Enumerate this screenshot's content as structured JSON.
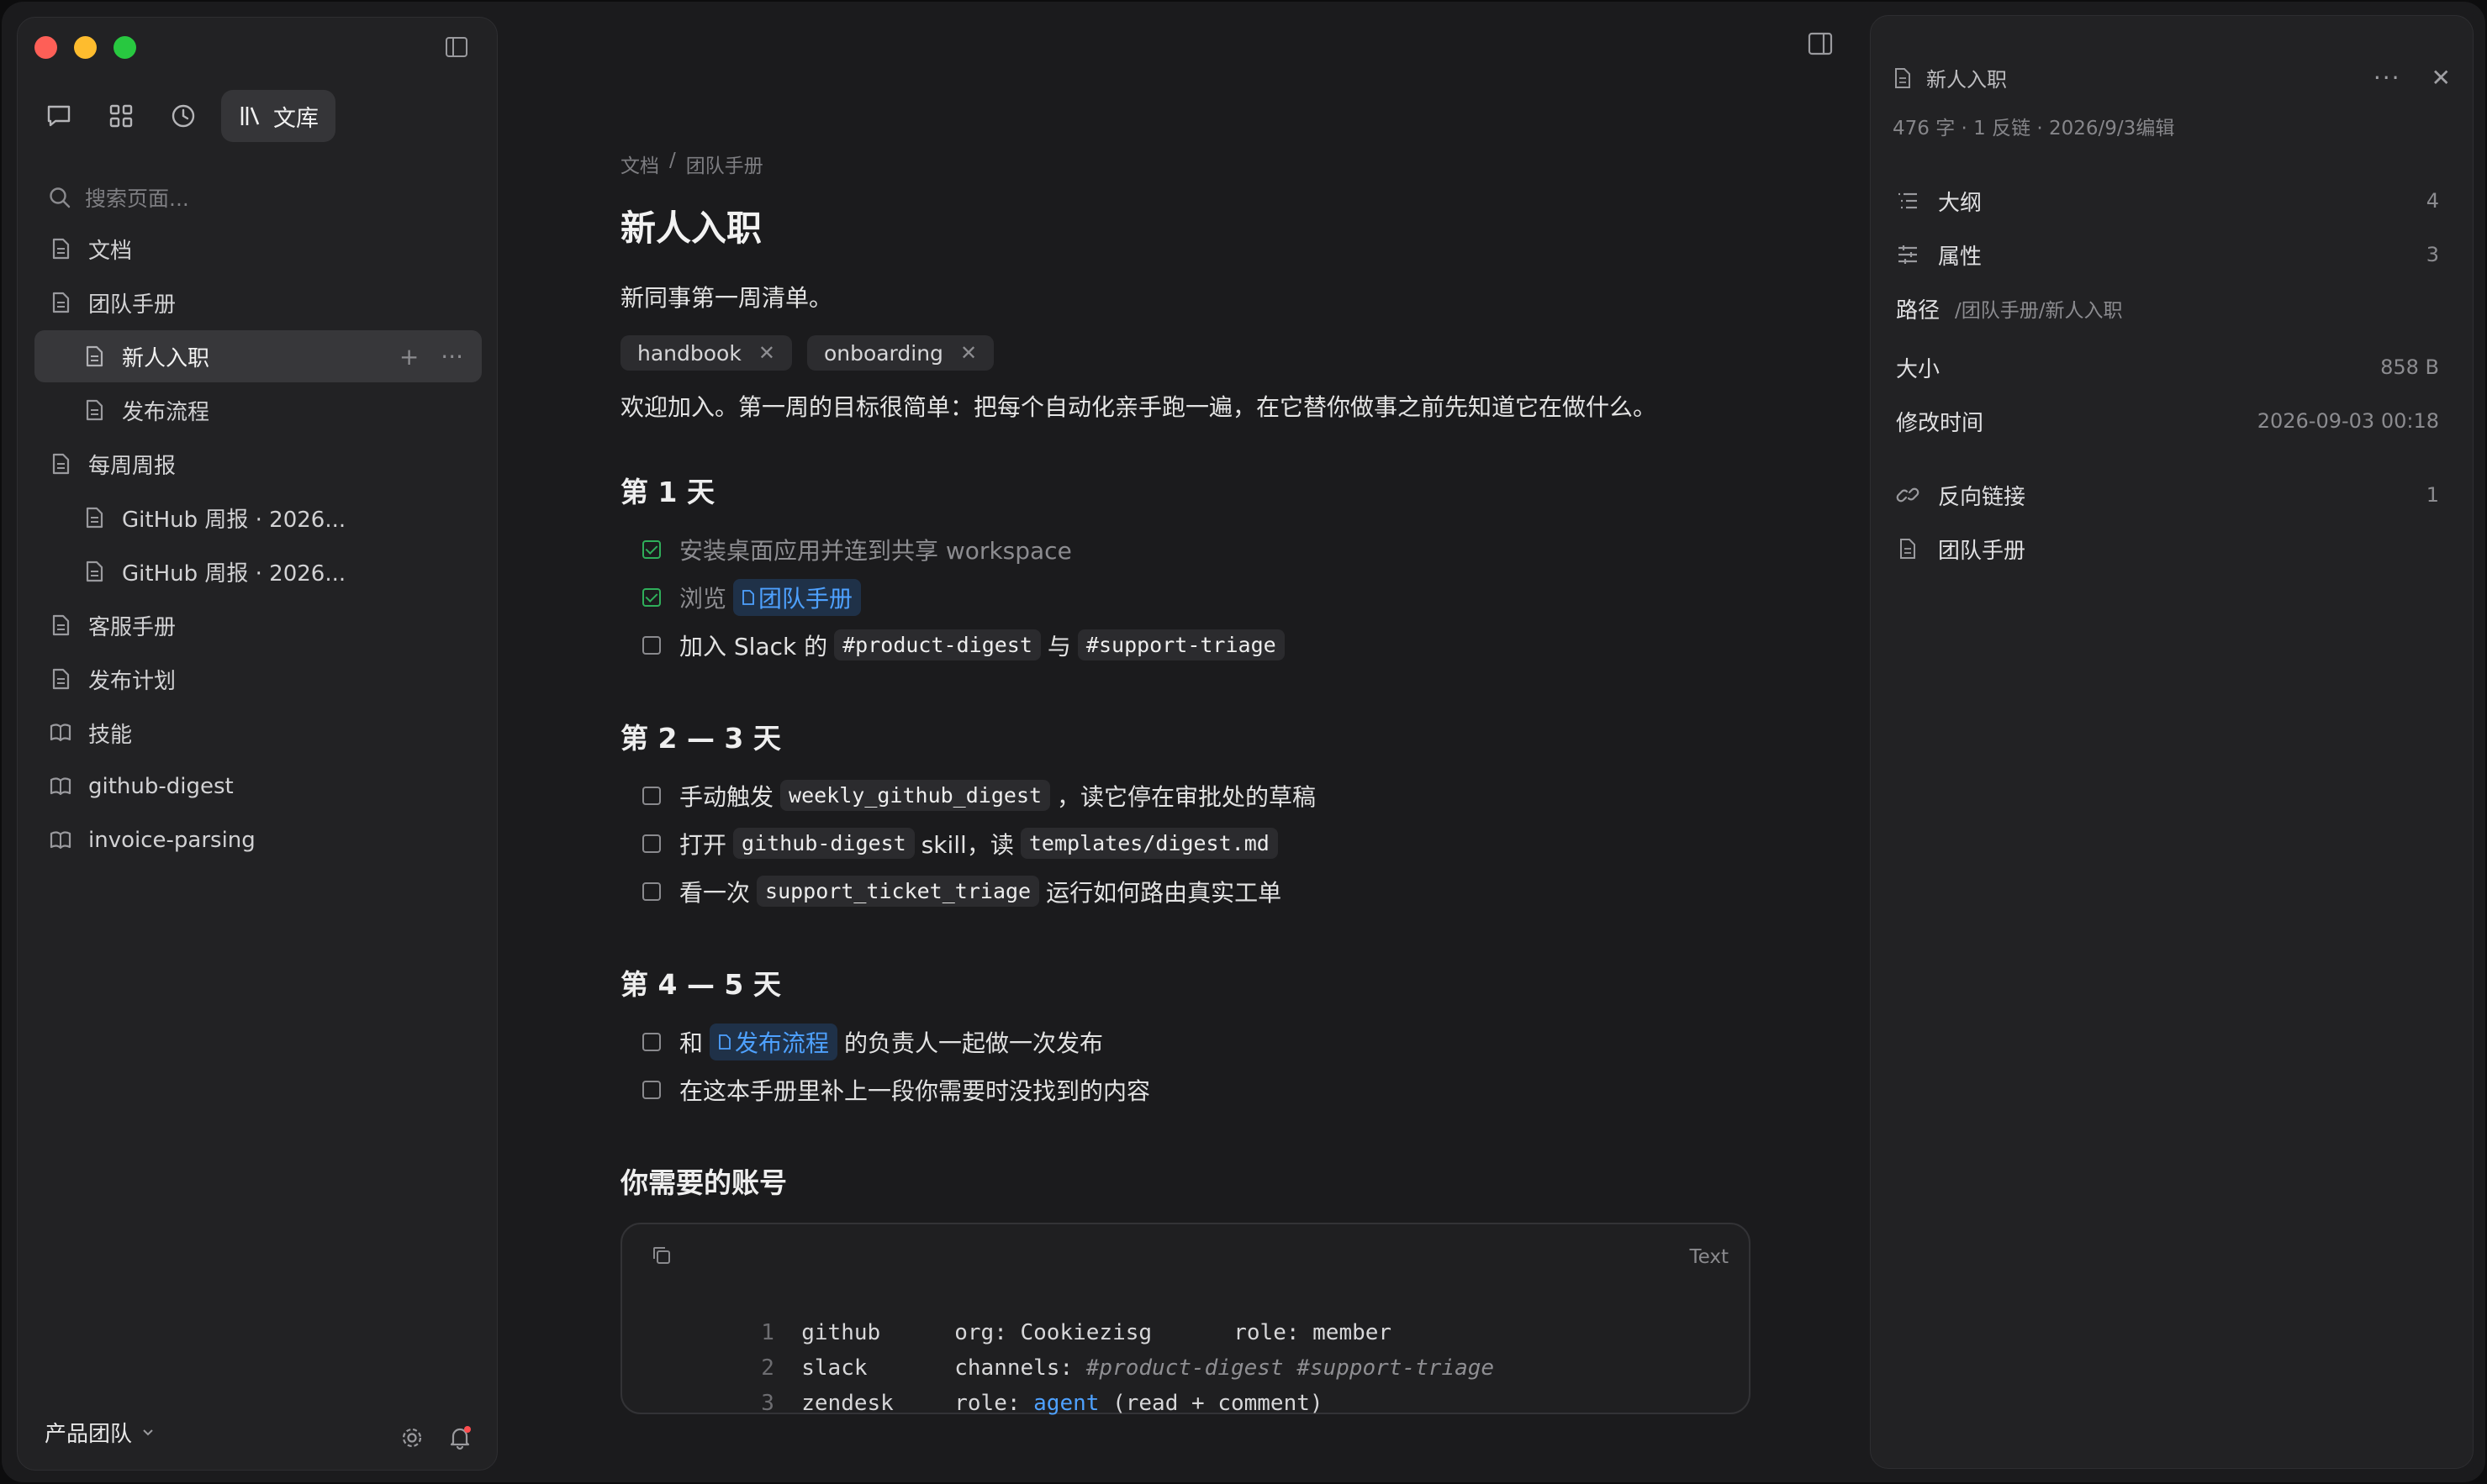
{
  "sidebar": {
    "tabs": {
      "active_label": "文库"
    },
    "search_placeholder": "搜索页面...",
    "tree": [
      {
        "label": "文档"
      },
      {
        "label": "团队手册"
      },
      {
        "label": "新人入职"
      },
      {
        "label": "发布流程"
      },
      {
        "label": "每周周报"
      },
      {
        "label": "GitHub 周报 · 2026..."
      },
      {
        "label": "GitHub 周报 · 2026..."
      },
      {
        "label": "客服手册"
      },
      {
        "label": "发布计划"
      },
      {
        "label": "技能"
      },
      {
        "label": "github-digest"
      },
      {
        "label": "invoice-parsing"
      }
    ],
    "workspace": "产品团队"
  },
  "doc": {
    "breadcrumb": [
      "文档",
      "团队手册"
    ],
    "title": "新人入职",
    "subtitle": "新同事第一周清单。",
    "tags": [
      "handbook",
      "onboarding"
    ],
    "intro": "欢迎加入。第一周的目标很简单：把每个自动化亲手跑一遍，在它替你做事之前先知道它在做什么。",
    "sections": [
      {
        "heading": "第 1 天",
        "tasks": [
          {
            "text": "安装桌面应用并连到共享 workspace"
          },
          {
            "pre": "浏览",
            "link": "团队手册"
          },
          {
            "pre": "加入 Slack 的",
            "code1": "#product-digest",
            "mid": "与",
            "code2": "#support-triage"
          }
        ]
      },
      {
        "heading": "第 2 — 3 天",
        "tasks": [
          {
            "pre": "手动触发",
            "code1": "weekly_github_digest",
            "post": "，读它停在审批处的草稿"
          },
          {
            "pre": "打开",
            "code1": "github-digest",
            "mid": "skill，读",
            "code2": "templates/digest.md"
          },
          {
            "pre": "看一次",
            "code1": "support_ticket_triage",
            "post": "运行如何路由真实工单"
          }
        ]
      },
      {
        "heading": "第 4 — 5 天",
        "tasks": [
          {
            "pre": "和",
            "link": "发布流程",
            "post": "的负责人一起做一次发布"
          },
          {
            "text": "在这本手册里补上一段你需要时没找到的内容"
          }
        ]
      }
    ],
    "accounts_heading": "你需要的账号",
    "codeblock": {
      "lang": "Text",
      "lines": [
        {
          "n": "1",
          "a": "github",
          "b": "org: Cookiezisg",
          "c": "role: member"
        },
        {
          "n": "2",
          "a": "slack",
          "b": "channels: ",
          "b_it": "#product-digest #support-triage"
        },
        {
          "n": "3",
          "a": "zendesk",
          "b": "role: ",
          "b_kw": "agent",
          "b_rest": " (read + comment)"
        }
      ]
    }
  },
  "panel": {
    "title": "新人入职",
    "meta": "476 字 · 1 反链 · 2026/9/3编辑",
    "outline_label": "大纲",
    "outline_count": "4",
    "props_label": "属性",
    "props_count": "3",
    "path_label": "路径",
    "path_value": "/团队手册/新人入职",
    "size_label": "大小",
    "size_value": "858 B",
    "modified_label": "修改时间",
    "modified_value": "2026-09-03 00:18",
    "backlinks_label": "反向链接",
    "backlinks_count": "1",
    "backlink_item": "团队手册"
  }
}
